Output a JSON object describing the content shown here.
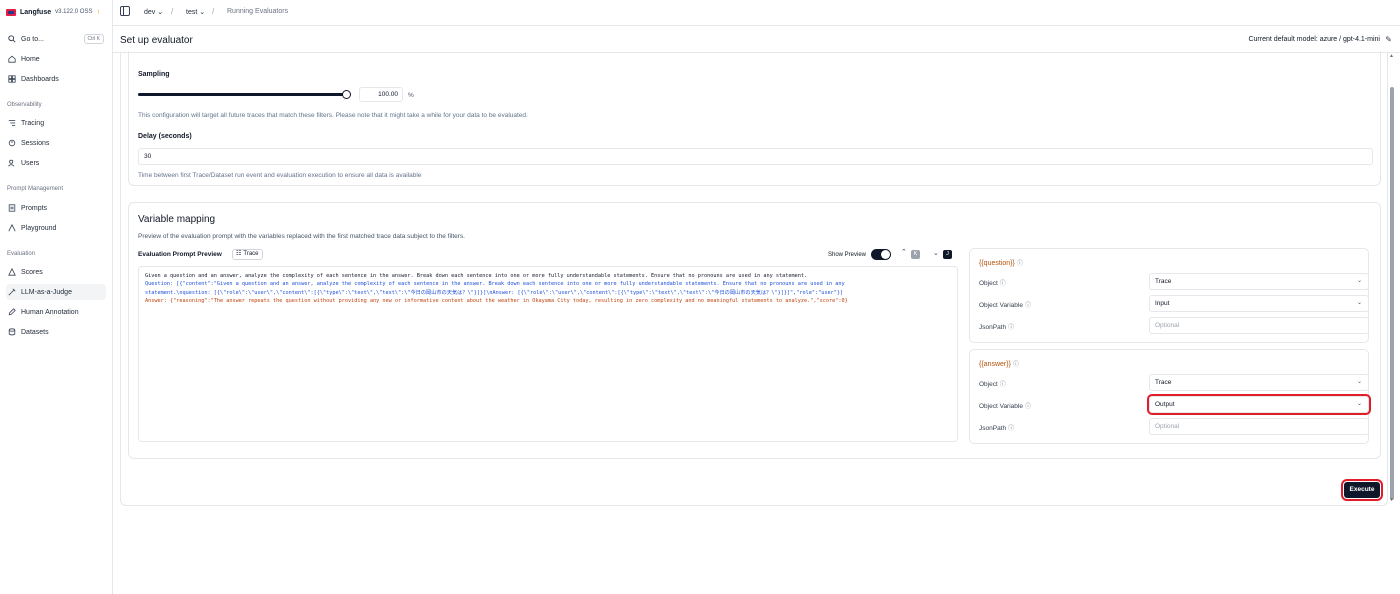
{
  "brand": {
    "name": "Langfuse",
    "version": "v3.122.0 OSS",
    "update_indicator": "↑"
  },
  "sidebar": {
    "goto": {
      "label": "Go to...",
      "shortcut": "Ctrl K"
    },
    "items_top": [
      {
        "label": "Home",
        "icon": "home-icon"
      },
      {
        "label": "Dashboards",
        "icon": "dashboard-icon"
      }
    ],
    "section_observability": "Observability",
    "items_observability": [
      {
        "label": "Tracing",
        "icon": "tracing-icon"
      },
      {
        "label": "Sessions",
        "icon": "sessions-icon"
      },
      {
        "label": "Users",
        "icon": "users-icon"
      }
    ],
    "section_prompt": "Prompt Management",
    "items_prompt": [
      {
        "label": "Prompts",
        "icon": "prompts-icon"
      },
      {
        "label": "Playground",
        "icon": "playground-icon"
      }
    ],
    "section_evaluation": "Evaluation",
    "items_evaluation": [
      {
        "label": "Scores",
        "icon": "scores-icon"
      },
      {
        "label": "LLM-as-a-Judge",
        "icon": "judge-icon",
        "active": true
      },
      {
        "label": "Human Annotation",
        "icon": "annotation-icon"
      },
      {
        "label": "Datasets",
        "icon": "datasets-icon"
      }
    ]
  },
  "breadcrumb": {
    "org": "dev",
    "project": "test",
    "page": "Running Evaluators"
  },
  "header": {
    "title": "Set up evaluator",
    "model": "Current default model: azure / gpt-4.1-mini"
  },
  "sampling": {
    "label": "Sampling",
    "value": "100.00",
    "unit": "%",
    "fraction": 1.0,
    "help": "This configuration will target all future traces that match these filters. Please note that it might take a while for your data to be evaluated."
  },
  "delay": {
    "label": "Delay (seconds)",
    "value": "30",
    "help": "Time between first Trace/Dataset run event and evaluation execution to ensure all data is available"
  },
  "variable_mapping": {
    "title": "Variable mapping",
    "description": "Preview of the evaluation prompt with the variables replaced with the first matched trace data subject to the filters.",
    "preview_label": "Evaluation Prompt Preview",
    "trace_chip": "Trace",
    "show_preview_label": "Show Preview",
    "key_k": "K",
    "key_j": "J",
    "preview_lines": [
      "Given a question and an answer, analyze the complexity of each sentence in the answer. Break down each sentence into one or more fully understandable statements. Ensure that no pronouns are used in any statement.",
      "Question: [{\"content\":\"Given a question and an answer, analyze the complexity of each sentence in the answer. Break down each sentence into one or more fully understandable statements. Ensure that no pronouns are used in any",
      "statement.\\nquestion: [{\\\"role\\\":\\\"user\\\",\\\"content\\\":[{\\\"type\\\":\\\"text\\\",\\\"text\\\":\\\"今日の岡山市の天気は？\\\"}]}]\\nAnswer: [{\\\"role\\\":\\\"user\\\",\\\"content\\\":[{\\\"type\\\":\\\"text\\\",\\\"text\\\":\\\"今日の岡山市の天気は？\\\"}]}]\",\"role\":\"user\"}]",
      "Answer: {\"reasoning\":\"The answer repeats the question without providing any new or informative content about the weather in Okayama City today, resulting in zero complexity and no meaningful statements to analyze.\",\"score\":0}"
    ],
    "variables": [
      {
        "name": "{{question}}",
        "object_label": "Object",
        "object_value": "Trace",
        "object_variable_label": "Object Variable",
        "object_variable_value": "Input",
        "jsonpath_label": "JsonPath",
        "jsonpath_placeholder": "Optional"
      },
      {
        "name": "{{answer}}",
        "object_label": "Object",
        "object_value": "Trace",
        "object_variable_label": "Object Variable",
        "object_variable_value": "Output",
        "jsonpath_label": "JsonPath",
        "jsonpath_placeholder": "Optional"
      }
    ]
  },
  "execute_label": "Execute",
  "colors": {
    "accent": "#0f172a",
    "highlight": "#e11d2a",
    "variable": "#b45309"
  }
}
